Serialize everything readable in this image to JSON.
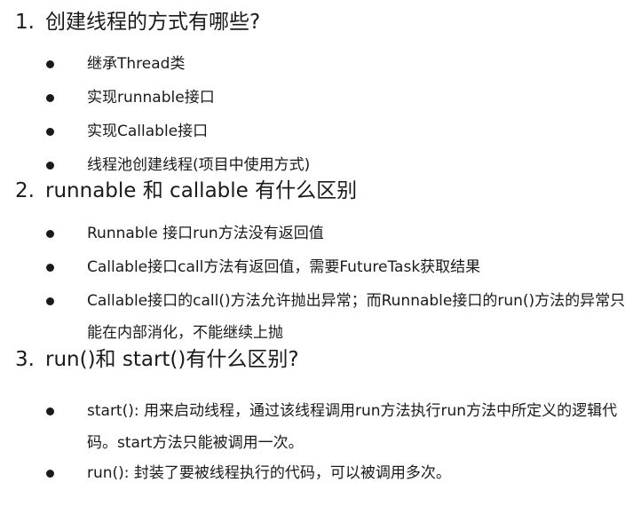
{
  "sections": [
    {
      "number": "1.",
      "title": "创建线程的方式有哪些?",
      "items": [
        "继承Thread类",
        "实现runnable接口",
        "实现Callable接口",
        "线程池创建线程(项目中使用方式)"
      ]
    },
    {
      "number": "2.",
      "title": "runnable 和 callable 有什么区别",
      "items": [
        "Runnable 接口run方法没有返回值",
        "Callable接口call方法有返回值，需要FutureTask获取结果",
        "Callable接口的call()方法允许抛出异常；而Runnable接口的run()方法的异常只能在内部消化，不能继续上抛"
      ]
    },
    {
      "number": "3.",
      "title": "run()和 start()有什么区别?",
      "items": [
        "start(): 用来启动线程，通过该线程调用run方法执行run方法中所定义的逻辑代码。start方法只能被调用一次。",
        "run(): 封装了要被线程执行的代码，可以被调用多次。"
      ]
    }
  ]
}
